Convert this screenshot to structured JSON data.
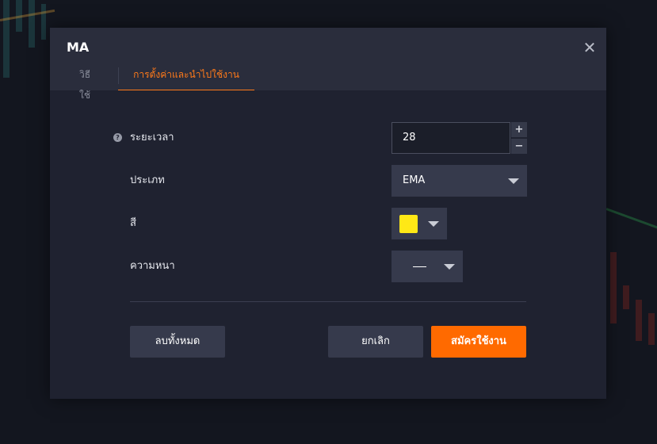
{
  "modal": {
    "title": "MA",
    "close_glyph": "✕",
    "tabs": [
      {
        "label": "วิธีใช้",
        "active": false
      },
      {
        "label": "การตั้งค่าและนำไปใช้งาน",
        "active": true
      }
    ]
  },
  "form": {
    "period": {
      "label": "ระยะเวลา",
      "value": "28",
      "help_icon": "?",
      "increment_glyph": "+",
      "decrement_glyph": "−"
    },
    "type": {
      "label": "ประเภท",
      "value": "EMA"
    },
    "color": {
      "label": "สี",
      "value": "#ffe816"
    },
    "thickness": {
      "label": "ความหนา"
    }
  },
  "buttons": {
    "reset": "ลบทั้งหมด",
    "cancel": "ยกเลิก",
    "apply": "สมัครใช้งาน"
  },
  "colors": {
    "accent": "#ff6a00",
    "panel": "#1f2230",
    "header": "#2a2d3c",
    "control": "#363a4c"
  }
}
